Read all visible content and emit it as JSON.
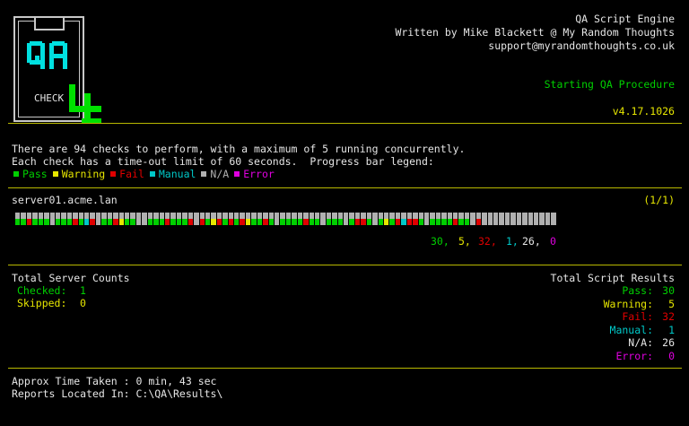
{
  "logo": {
    "qa_text": "QA",
    "check_text": "CHECK",
    "number": "4"
  },
  "header": {
    "title": "QA Script Engine",
    "author": "Written by Mike Blackett @ My Random Thoughts",
    "email": "support@myrandomthoughts.co.uk",
    "status": "Starting QA Procedure",
    "version": "v4.17.1026"
  },
  "intro": {
    "line1": "There are 94 checks to perform, with a maximum of 5 running concurrently.",
    "line2": "Each check has a time-out limit of 60 seconds.  Progress bar legend:",
    "legend": [
      {
        "label": "Pass",
        "color": "#00d000"
      },
      {
        "label": "Warning",
        "color": "#e6e600"
      },
      {
        "label": "Fail",
        "color": "#e00000"
      },
      {
        "label": "Manual",
        "color": "#00c8c8"
      },
      {
        "label": "N/A",
        "color": "#b0b0b0"
      },
      {
        "label": "Error",
        "color": "#e000e0"
      }
    ]
  },
  "server": {
    "name": "server01.acme.lan",
    "position": "(1/1)",
    "progress": {
      "total_checks": 94,
      "results": [
        "pass",
        "pass",
        "fail",
        "pass",
        "pass",
        "pass",
        "na",
        "pass",
        "pass",
        "pass",
        "fail",
        "pass",
        "manual",
        "fail",
        "na",
        "pass",
        "pass",
        "fail",
        "warning",
        "pass",
        "pass",
        "na",
        "na",
        "pass",
        "pass",
        "pass",
        "fail",
        "pass",
        "pass",
        "pass",
        "fail",
        "na",
        "fail",
        "pass",
        "warning",
        "fail",
        "pass",
        "fail",
        "pass",
        "fail",
        "warning",
        "pass",
        "pass",
        "fail",
        "pass",
        "na",
        "pass",
        "pass",
        "pass",
        "pass",
        "fail",
        "pass",
        "pass",
        "na",
        "pass",
        "pass",
        "pass",
        "na",
        "pass",
        "fail",
        "fail",
        "pass",
        "na",
        "pass",
        "warning",
        "pass",
        "fail",
        "manual",
        "fail",
        "fail",
        "pass",
        "na",
        "pass",
        "pass",
        "pass",
        "pass",
        "fail",
        "pass",
        "pass",
        "na",
        "fail",
        "na",
        "na",
        "na",
        "na",
        "na",
        "na",
        "na",
        "na",
        "na",
        "na",
        "na",
        "na",
        "na"
      ]
    },
    "counts": {
      "pass": "30,",
      "warning": "5,",
      "fail": "32,",
      "manual": "1,",
      "na": "26,",
      "error": "0"
    }
  },
  "server_counts": {
    "title": "Total Server Counts",
    "checked_label": "Checked:",
    "checked_value": "1",
    "skipped_label": "Skipped:",
    "skipped_value": "0"
  },
  "script_results": {
    "title": "Total Script Results",
    "rows": [
      {
        "label": "Pass:",
        "value": "30",
        "color": "#00d000"
      },
      {
        "label": "Warning:",
        "value": "5",
        "color": "#e6e600"
      },
      {
        "label": "Fail:",
        "value": "32",
        "color": "#e00000"
      },
      {
        "label": "Manual:",
        "value": "1",
        "color": "#00c8c8"
      },
      {
        "label": "N/A:",
        "value": "26",
        "color": "#e6e6e6"
      },
      {
        "label": "Error:",
        "value": "0",
        "color": "#e000e0"
      }
    ]
  },
  "footer": {
    "time_taken": "Approx Time Taken : 0 min, 43 sec",
    "reports": "Reports Located In: C:\\QA\\Results\\"
  },
  "colors": {
    "pass": "#00d000",
    "warning": "#e6e600",
    "fail": "#e00000",
    "manual": "#00c8c8",
    "na": "#b0b0b0",
    "error": "#e000e0",
    "rule": "#b8b800"
  }
}
